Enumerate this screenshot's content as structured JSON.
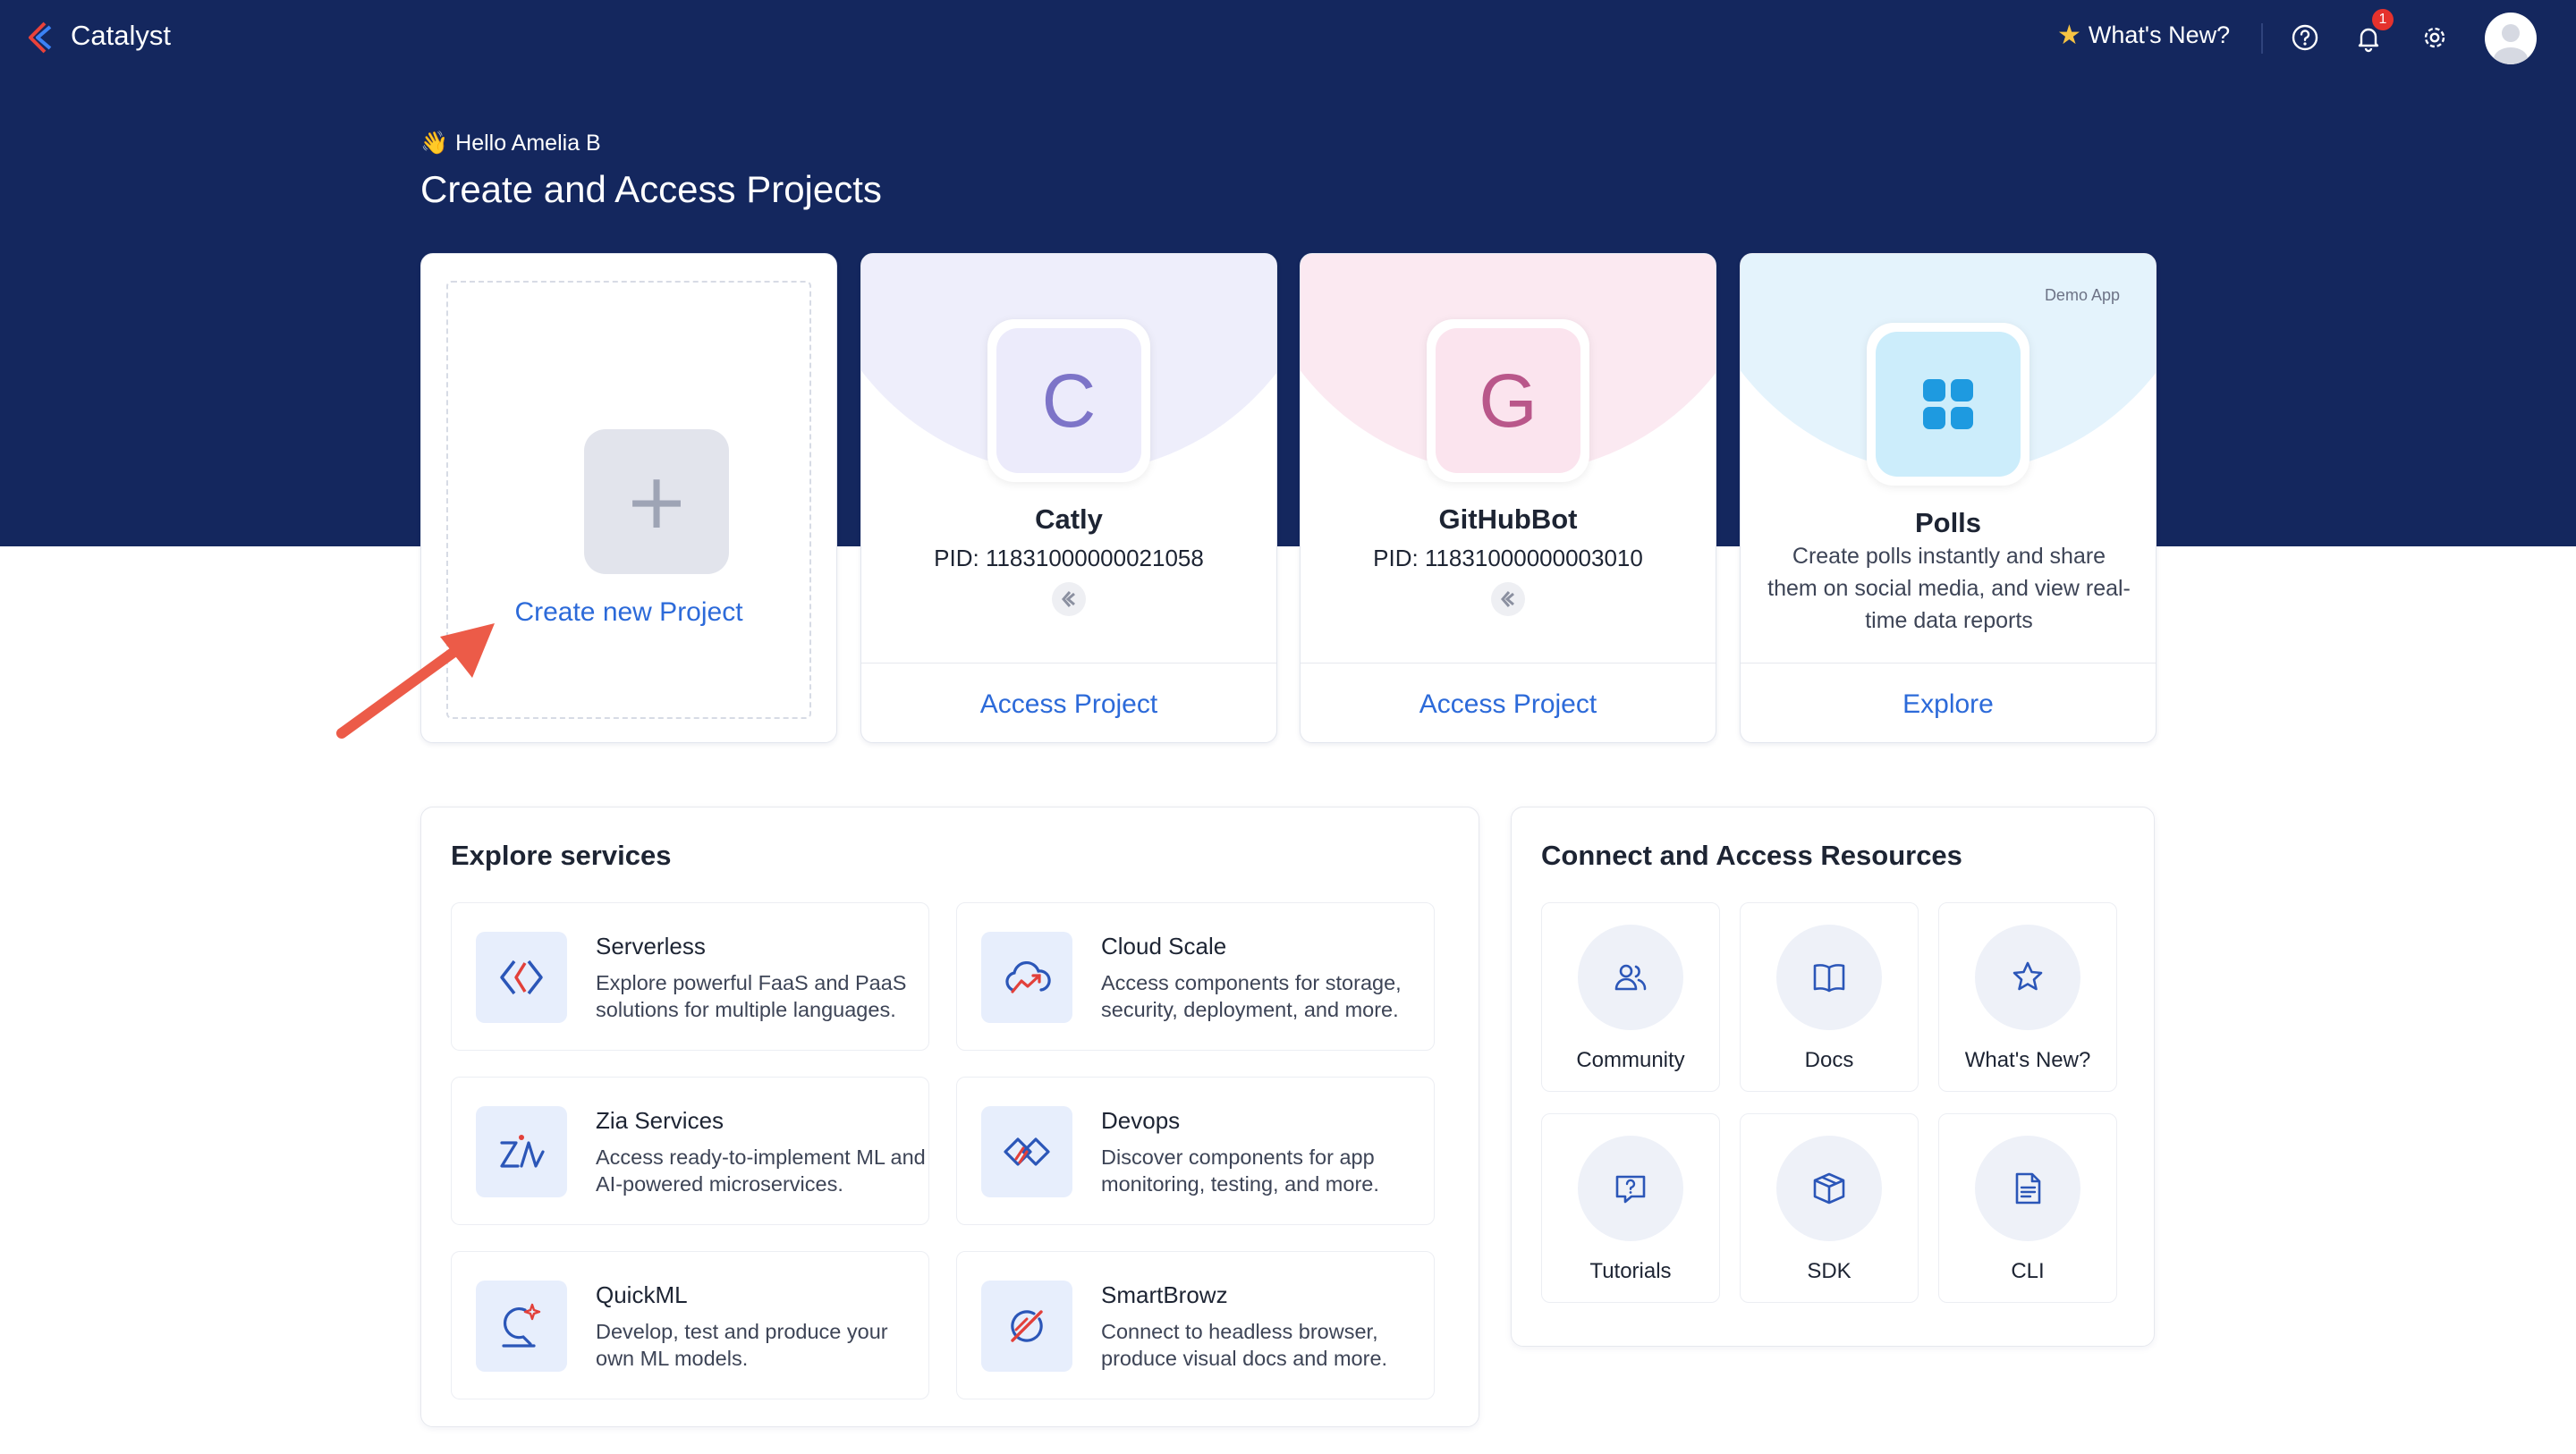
{
  "topbar": {
    "brand": "Catalyst",
    "whats_new": "What's New?",
    "notification_count": "1"
  },
  "hero": {
    "greeting": "Hello Amelia B",
    "title": "Create and Access Projects"
  },
  "project_cards": {
    "create": {
      "label": "Create new Project"
    },
    "items": [
      {
        "initial": "C",
        "name": "Catly",
        "pid": "PID: 11831000000021058",
        "action": "Access Project"
      },
      {
        "initial": "G",
        "name": "GitHubBot",
        "pid": "PID: 11831000000003010",
        "action": "Access Project"
      }
    ],
    "demo": {
      "tag": "Demo App",
      "name": "Polls",
      "description": "Create polls instantly and share them on social media, and view real-time data reports",
      "action": "Explore"
    }
  },
  "services": {
    "title": "Explore services",
    "items": [
      {
        "name": "Serverless",
        "description": "Explore powerful FaaS and PaaS solutions for multiple languages."
      },
      {
        "name": "Cloud Scale",
        "description": "Access components for storage, security, deployment, and more."
      },
      {
        "name": "Zia Services",
        "description": "Access ready-to-implement ML and AI-powered microservices."
      },
      {
        "name": "Devops",
        "description": "Discover components for app monitoring, testing, and more."
      },
      {
        "name": "QuickML",
        "description": "Develop, test and produce your own ML models."
      },
      {
        "name": "SmartBrowz",
        "description": "Connect to headless browser, produce visual docs and more."
      }
    ]
  },
  "resources": {
    "title": "Connect and Access Resources",
    "items": [
      {
        "label": "Community",
        "icon": "community-icon"
      },
      {
        "label": "Docs",
        "icon": "docs-icon"
      },
      {
        "label": "What's New?",
        "icon": "star-icon"
      },
      {
        "label": "Tutorials",
        "icon": "tutorials-icon"
      },
      {
        "label": "SDK",
        "icon": "sdk-icon"
      },
      {
        "label": "CLI",
        "icon": "cli-icon"
      }
    ]
  },
  "colors": {
    "hero_bg": "#14275e",
    "link": "#2c6ad9",
    "annotation_arrow": "#ec5b48"
  }
}
